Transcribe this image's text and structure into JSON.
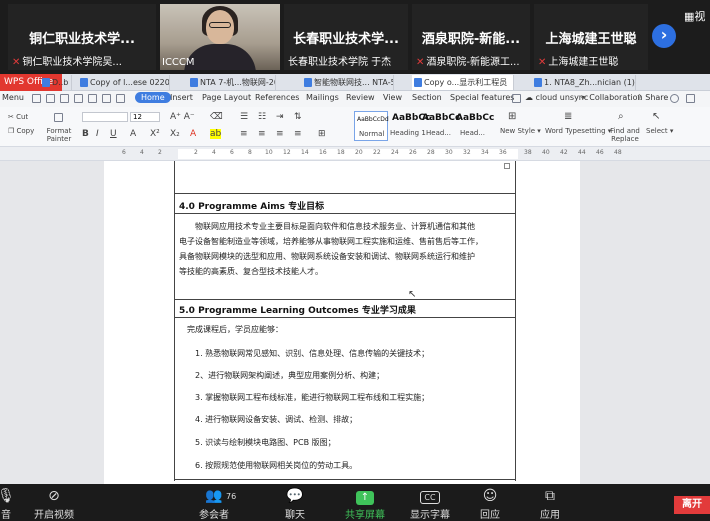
{
  "participants": [
    {
      "name": "铜仁职业技术学...",
      "sub": "铜仁职业技术学院吴..."
    },
    {
      "name": "",
      "sub": "ICCCM"
    },
    {
      "name": "长春职业技术学...",
      "sub": "长春职业技术学院 于杰"
    },
    {
      "name": "酒泉职院-新能...",
      "sub": "酒泉职院-新能源工..."
    },
    {
      "name": "上海城建王世聪",
      "sub": "上海城建王世聪"
    }
  ],
  "view_label": "视",
  "tabs": {
    "wps": "WPS Office",
    "docs": [
      "D..b",
      "Copy of l...ese 0220)",
      "NTA 7-机...物联网-2023",
      "智能物联网技... NTA-5",
      "Copy o...显示利工程员",
      "1. NTA8_Zh...nician (1)"
    ]
  },
  "menu": {
    "items": [
      "Menu",
      "Home",
      "Insert",
      "Page Layout",
      "References",
      "Mailings",
      "Review",
      "View",
      "Section",
      "Special features"
    ],
    "right": [
      "cloud unsync",
      "Collaboration",
      "Share"
    ]
  },
  "ribbon": {
    "cut": "Cut",
    "copy": "Copy",
    "format_painter": "Format Painter",
    "font_size": "12",
    "styles": [
      {
        "preview": "AaBbCcDd",
        "name": "Normal"
      },
      {
        "preview": "AaBbCc",
        "name": "Heading 1"
      },
      {
        "preview": "AaBbCc",
        "name": "Head..."
      },
      {
        "preview": "AaBbCc",
        "name": "Head..."
      }
    ],
    "new_style": "New Style",
    "word_typesetting": "Word Typesetting",
    "find_replace": "Find and Replace",
    "select": "Select"
  },
  "ruler": [
    "6",
    "4",
    "2",
    "2",
    "4",
    "6",
    "8",
    "10",
    "12",
    "14",
    "16",
    "18",
    "20",
    "22",
    "24",
    "26",
    "28",
    "30",
    "32",
    "34",
    "36",
    "38",
    "40",
    "42",
    "44",
    "46",
    "48"
  ],
  "document": {
    "section4_title": "4.0 Programme Aims 专业目标",
    "section4_lines": [
      "　　物联网应用技术专业主要目标是面向软件和信息技术服务业、计算机通信和其他",
      "电子设备智能制造业等领域，培养能够从事物联网工程实施和运维、售前售后等工作，",
      "具备物联网模块的选型和应用、物联网系统设备安装和调试、物联网系统运行和维护",
      "等技能的高素质、复合型技术技能人才。"
    ],
    "section5_title": "5.0 Programme Learning Outcomes 专业学习成果",
    "section5_lead": "完成课程后，学员应能够：",
    "section5_items": [
      "1. 熟悉物联网常见感知、识别、信息处理、信息传输的关键技术；",
      "2、进行物联网架构阐述，典型应用案例分析、构建；",
      "3. 掌握物联网工程布线标准，能进行物联网工程布线和工程实施；",
      "4. 进行物联网设备安装、调试、检测、排故；",
      "5. 识读与绘制模块电路图、PCB 版图；",
      "6. 按照规范使用物联网相关岗位的劳动工具。"
    ]
  },
  "bottom": {
    "items": [
      {
        "label": "音",
        "icon": "audio-icon"
      },
      {
        "label": "开启视频",
        "icon": "video-off-icon"
      },
      {
        "label": "参会者",
        "icon": "participants-icon",
        "count": "76"
      },
      {
        "label": "聊天",
        "icon": "chat-icon"
      },
      {
        "label": "共享屏幕",
        "icon": "share-screen-icon"
      },
      {
        "label": "显示字幕",
        "icon": "captions-icon"
      },
      {
        "label": "回应",
        "icon": "reactions-icon"
      },
      {
        "label": "应用",
        "icon": "apps-icon"
      }
    ],
    "cc": "CC",
    "leave": "离开"
  },
  "colors": {
    "share_green": "#3fc35a",
    "leave_red": "#e23b3b",
    "wps_red": "#e2372f",
    "accent_blue": "#3f7de0"
  }
}
